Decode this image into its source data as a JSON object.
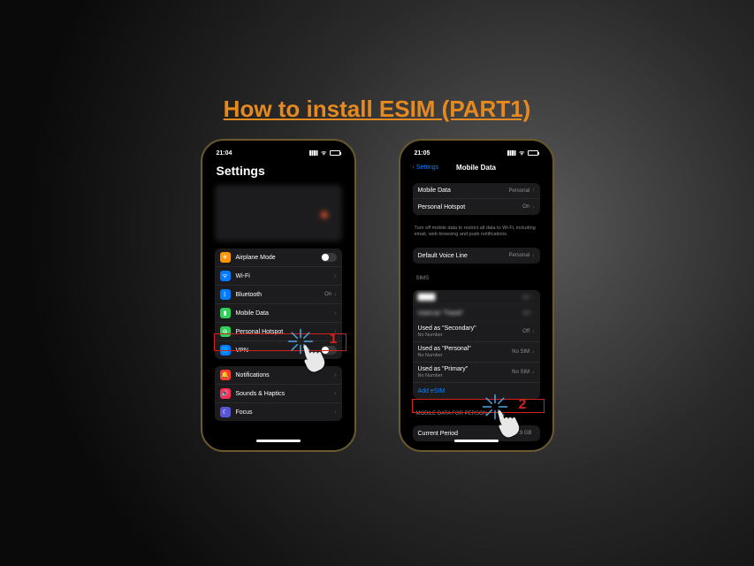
{
  "title": "How to install ESIM (PART1)",
  "left": {
    "time": "21:04",
    "screen_title": "Settings",
    "rows": {
      "airplane": "Airplane Mode",
      "wifi": "Wi-Fi",
      "wifi_value": "",
      "bluetooth": "Bluetooth",
      "bluetooth_value": "On",
      "mobile": "Mobile Data",
      "hotspot": "Personal Hotspot",
      "vpn": "VPN",
      "notifications": "Notifications",
      "sounds": "Sounds & Haptics",
      "focus": "Focus"
    },
    "step": "1"
  },
  "right": {
    "time": "21:05",
    "back": "Settings",
    "screen_title": "Mobile Data",
    "rows": {
      "mobile_data": "Mobile Data",
      "mobile_data_value": "Personal",
      "hotspot": "Personal Hotspot",
      "hotspot_value": "On",
      "hint": "Turn off mobile data to restrict all data to Wi-Fi, including email, web browsing and push notifications.",
      "default_voice": "Default Voice Line",
      "default_voice_value": "Personal",
      "sims_header": "SIMs",
      "sim_on": "On",
      "sim_travel": "Used as \"Travel\"",
      "sim_off": "Off",
      "sim_secondary": "Used as \"Secondary\"",
      "sim_personal": "Used as \"Personal\"",
      "sim_primary": "Used as \"Primary\"",
      "no_number": "No Number",
      "no_sim": "No SIM",
      "add_esim": "Add eSIM",
      "data_header": "MOBILE DATA FOR PERSON",
      "current_period": "Current Period",
      "current_period_value": "7.9 GB"
    },
    "step": "2"
  }
}
